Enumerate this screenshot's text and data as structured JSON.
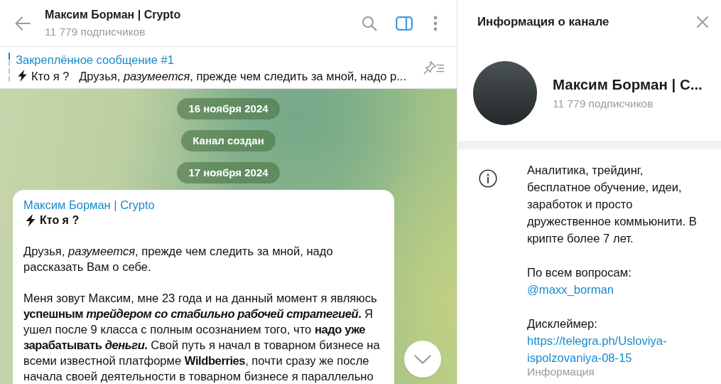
{
  "chat_header": {
    "title": "Максим Борман | Crypto",
    "subtitle": "11 779 подписчиков",
    "info_panel_button": {
      "selected": true
    }
  },
  "pinned": {
    "title": "Закреплённое сообщение #1",
    "preview": "Кто я ?   Друзья, *разумеется*, прежде чем следить за мной, надо р..."
  },
  "service_messages": [
    "16 ноября 2024",
    "Канал создан",
    "17 ноября 2024"
  ],
  "message": {
    "author": "Максим Борман | Crypto",
    "heading": "Кто я ?",
    "paragraphs": [
      "Друзья, *разумеется*, прежде чем следить за мной, надо рассказать Вам о себе.",
      "Меня зовут Максим, мне 23 года и на данный момент я являюсь **успешным *трейдером со стабильно рабочей стратегией*.** Я ушел после 9 класса с полным осознанием того, что **надо уже зарабатывать *деньги*.** Свой путь я начал в товарном бизнесе на всеми известной платформе **Wildberries**, почти сразу же после начала своей деятельности в товарном бизнесе я параллельно"
    ]
  },
  "info_panel": {
    "title": "Информация о канале",
    "name": "Максим Борман | С...",
    "subscribers": "11 779 подписчиков",
    "about": [
      {
        "text": "Аналитика, трейдинг, бесплатное обучение, идеи, заработок и просто дружественное коммьюнити. В крипте более 7 лет."
      },
      {
        "text": "По всем вопросам:",
        "link": "@maxx_borman"
      },
      {
        "text": "Дисклеймер:",
        "link": "https://telegra.ph/Usloviya-ispolzovaniya-08-15"
      }
    ],
    "about_label": "Информация"
  }
}
